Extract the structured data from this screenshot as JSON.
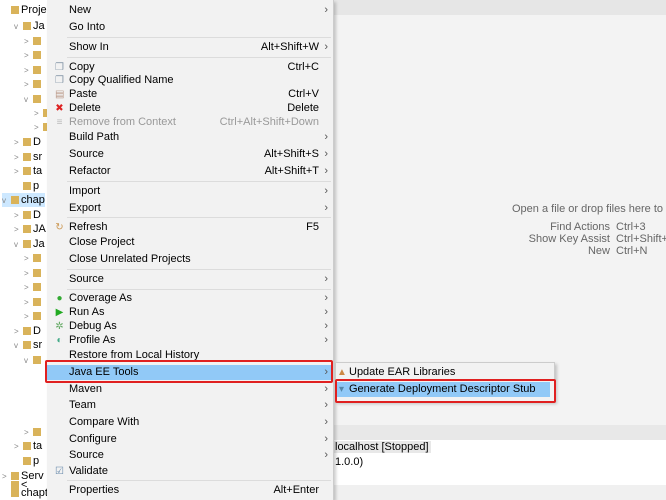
{
  "tree": [
    {
      "label": "Project",
      "twisty": ""
    },
    {
      "label": "Ja",
      "twisty": "v"
    },
    {
      "label": "",
      "twisty": ">"
    },
    {
      "label": "",
      "twisty": ">"
    },
    {
      "label": "",
      "twisty": ">"
    },
    {
      "label": "",
      "twisty": ">"
    },
    {
      "label": "",
      "twisty": "v"
    },
    {
      "label": "",
      "twisty": ">"
    },
    {
      "label": "",
      "twisty": ">"
    },
    {
      "label": "D",
      "twisty": ">"
    },
    {
      "label": "sr",
      "twisty": ">"
    },
    {
      "label": "ta",
      "twisty": ">"
    },
    {
      "label": "p",
      "twisty": ""
    },
    {
      "label": "chap",
      "twisty": "v"
    },
    {
      "label": "D",
      "twisty": ">"
    },
    {
      "label": "JA",
      "twisty": ">"
    },
    {
      "label": "Ja",
      "twisty": "v"
    },
    {
      "label": "",
      "twisty": ">"
    },
    {
      "label": "",
      "twisty": ">"
    },
    {
      "label": "",
      "twisty": ">"
    },
    {
      "label": "",
      "twisty": ">"
    },
    {
      "label": "",
      "twisty": ">"
    },
    {
      "label": "D",
      "twisty": ">"
    },
    {
      "label": "sr",
      "twisty": "v"
    },
    {
      "label": "",
      "twisty": "v"
    },
    {
      "label": "",
      "twisty": ">"
    },
    {
      "label": "ta",
      "twisty": ">"
    },
    {
      "label": "p",
      "twisty": ""
    },
    {
      "label": "Serv",
      "twisty": ">"
    },
    {
      "label": "<",
      "twisty": ""
    },
    {
      "label": "chapte",
      "twisty": ""
    }
  ],
  "menu": [
    {
      "label": "New",
      "shortcut": "",
      "arrow": true
    },
    {
      "label": "Go Into",
      "shortcut": ""
    },
    {
      "label": "Show In",
      "shortcut": "Alt+Shift+W",
      "arrow": true
    },
    {
      "label": "Copy",
      "shortcut": "Ctrl+C",
      "icon": "copy-icon"
    },
    {
      "label": "Copy Qualified Name",
      "shortcut": "",
      "icon": "copy-qualified-icon"
    },
    {
      "label": "Paste",
      "shortcut": "Ctrl+V",
      "icon": "paste-icon"
    },
    {
      "label": "Delete",
      "shortcut": "Delete",
      "icon": "delete-icon"
    },
    {
      "label": "Remove from Context",
      "shortcut": "Ctrl+Alt+Shift+Down",
      "disabled": true,
      "icon": "remove-context-icon"
    },
    {
      "label": "Build Path",
      "shortcut": "",
      "arrow": true
    },
    {
      "label": "Source",
      "shortcut": "Alt+Shift+S",
      "arrow": true
    },
    {
      "label": "Refactor",
      "shortcut": "Alt+Shift+T",
      "arrow": true
    },
    {
      "label": "Import",
      "shortcut": "",
      "arrow": true
    },
    {
      "label": "Export",
      "shortcut": "",
      "arrow": true
    },
    {
      "label": "Refresh",
      "shortcut": "F5",
      "icon": "refresh-icon"
    },
    {
      "label": "Close Project",
      "shortcut": ""
    },
    {
      "label": "Close Unrelated Projects",
      "shortcut": ""
    },
    {
      "label": "Source",
      "shortcut": "",
      "arrow": true
    },
    {
      "label": "Coverage As",
      "shortcut": "",
      "arrow": true,
      "icon": "coverage-icon"
    },
    {
      "label": "Run As",
      "shortcut": "",
      "arrow": true,
      "icon": "run-icon"
    },
    {
      "label": "Debug As",
      "shortcut": "",
      "arrow": true,
      "icon": "debug-icon"
    },
    {
      "label": "Profile As",
      "shortcut": "",
      "arrow": true,
      "icon": "profile-icon"
    },
    {
      "label": "Restore from Local History",
      "shortcut": ""
    },
    {
      "label": "Java EE Tools",
      "shortcut": "",
      "arrow": true,
      "highlighted": true
    },
    {
      "label": "Maven",
      "shortcut": "",
      "arrow": true
    },
    {
      "label": "Team",
      "shortcut": "",
      "arrow": true
    },
    {
      "label": "Compare With",
      "shortcut": "",
      "arrow": true
    },
    {
      "label": "Configure",
      "shortcut": "",
      "arrow": true
    },
    {
      "label": "Source",
      "shortcut": "",
      "arrow": true
    },
    {
      "label": "Validate",
      "shortcut": "",
      "icon": "validate-icon"
    },
    {
      "label": "Properties",
      "shortcut": "Alt+Enter"
    }
  ],
  "submenu": [
    {
      "label": "Update EAR Libraries",
      "icon": "ear-libraries-icon"
    },
    {
      "label": "Generate Deployment Descriptor Stub",
      "icon": "descriptor-icon",
      "highlighted": true
    }
  ],
  "editor_hints": {
    "open": "Open a file or drop files here to op",
    "find_label": "Find Actions",
    "find_key": "Ctrl+3",
    "assist_label": "Show Key Assist",
    "assist_key": "Ctrl+Shift+",
    "new_label": "New",
    "new_key": "Ctrl+N"
  },
  "servers": {
    "line1": "localhost  [Stopped]",
    "line2": "1.0.0)"
  },
  "colors": {
    "highlight": "#91c9f7",
    "annotation": "#e02020"
  }
}
